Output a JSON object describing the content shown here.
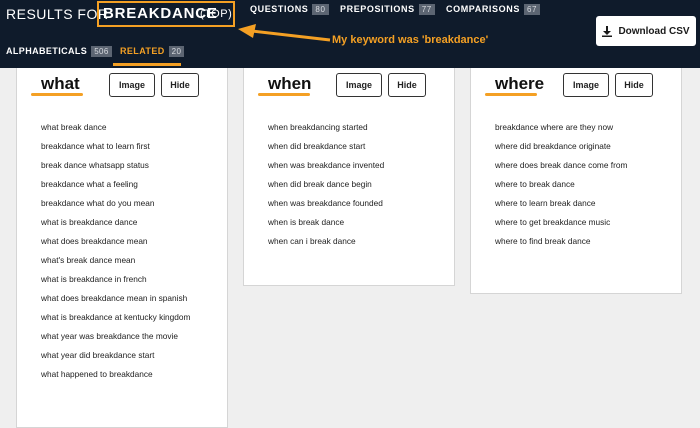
{
  "header": {
    "results_prefix": "RESULTS FOR",
    "keyword": "BREAKDANCE",
    "keyword_tag": "(TOP)",
    "tabs": [
      {
        "label": "QUESTIONS",
        "count": "80"
      },
      {
        "label": "PREPOSITIONS",
        "count": "77"
      },
      {
        "label": "COMPARISONS",
        "count": "67"
      }
    ],
    "subtabs": [
      {
        "label": "ALPHABETICALS",
        "count": "506"
      },
      {
        "label": "RELATED",
        "count": "20"
      }
    ],
    "download_label": "Download CSV",
    "annotation": "My keyword was 'breakdance'"
  },
  "colors": {
    "header_bg": "#0f1b2b",
    "accent": "#f4a024",
    "page_bg": "#efefef"
  },
  "columns": [
    {
      "heading": "what",
      "image_label": "Image",
      "hide_label": "Hide",
      "items": [
        "what break dance",
        "breakdance what to learn first",
        "break dance whatsapp status",
        "breakdance what a feeling",
        "breakdance what do you mean",
        "what is breakdance dance",
        "what does breakdance mean",
        "what's break dance mean",
        "what is breakdance in french",
        "what does breakdance mean in spanish",
        "what is breakdance at kentucky kingdom",
        "what year was breakdance the movie",
        "what year did breakdance start",
        "what happened to breakdance"
      ]
    },
    {
      "heading": "when",
      "image_label": "Image",
      "hide_label": "Hide",
      "items": [
        "when breakdancing started",
        "when did breakdance start",
        "when was breakdance invented",
        "when did break dance begin",
        "when was breakdance founded",
        "when is break dance",
        "when can i break dance"
      ]
    },
    {
      "heading": "where",
      "image_label": "Image",
      "hide_label": "Hide",
      "items": [
        "breakdance where are they now",
        "where did breakdance originate",
        "where does break dance come from",
        "where to break dance",
        "where to learn break dance",
        "where to get breakdance music",
        "where to find break dance"
      ]
    }
  ]
}
